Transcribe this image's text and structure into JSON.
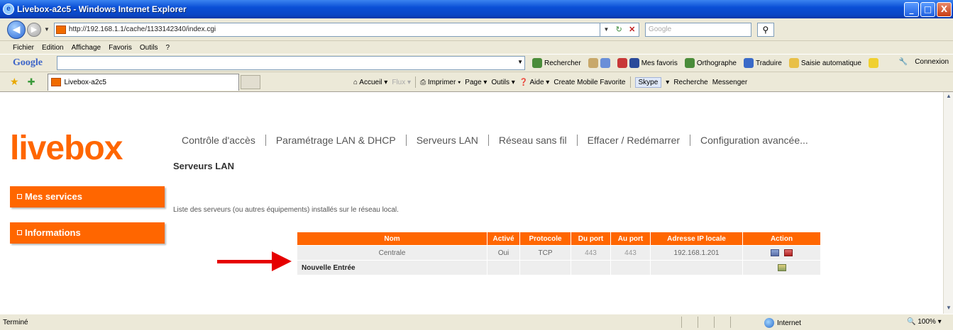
{
  "window": {
    "title": "Livebox-a2c5 - Windows Internet Explorer",
    "controls": [
      "_",
      "□",
      "X"
    ]
  },
  "address": {
    "url": "http://192.168.1.1/cache/1133142340/index.cgi",
    "search_placeholder": "Google"
  },
  "menu": [
    "Fichier",
    "Edition",
    "Affichage",
    "Favoris",
    "Outils",
    "?"
  ],
  "google_toolbar": {
    "logo": "Google",
    "items": [
      "Rechercher",
      "Mes favoris",
      "Orthographe",
      "Traduire",
      "Saisie automatique"
    ],
    "connexion": "Connexion"
  },
  "tab": {
    "label": "Livebox-a2c5"
  },
  "commands": [
    "Accueil",
    "Flux",
    "Imprimer",
    "Page",
    "Outils",
    "Aide",
    "Create Mobile Favorite",
    "Skype",
    "Recherche",
    "Messenger"
  ],
  "page": {
    "logo": "livebox",
    "nav": [
      "Contrôle d'accès",
      "Paramétrage LAN & DHCP",
      "Serveurs LAN",
      "Réseau sans fil",
      "Effacer / Redémarrer",
      "Configuration avancée..."
    ],
    "subtitle": "Serveurs LAN",
    "side": [
      "Mes services",
      "Informations"
    ],
    "description": "Liste des serveurs (ou autres équipements) installés sur le réseau local.",
    "table": {
      "headers": [
        "Nom",
        "Activé",
        "Protocole",
        "Du port",
        "Au port",
        "Adresse IP locale",
        "Action"
      ],
      "rows": [
        {
          "nom": "Centrale",
          "active": "Oui",
          "protocole": "TCP",
          "du_port": "443",
          "au_port": "443",
          "ip": "192.168.1.201"
        }
      ],
      "new_entry": "Nouvelle Entrée"
    }
  },
  "status": {
    "text": "Terminé",
    "zone": "Internet",
    "zoom": "100%"
  },
  "colors": {
    "brand_orange": "#ff6600",
    "arrow_red": "#e60000"
  }
}
